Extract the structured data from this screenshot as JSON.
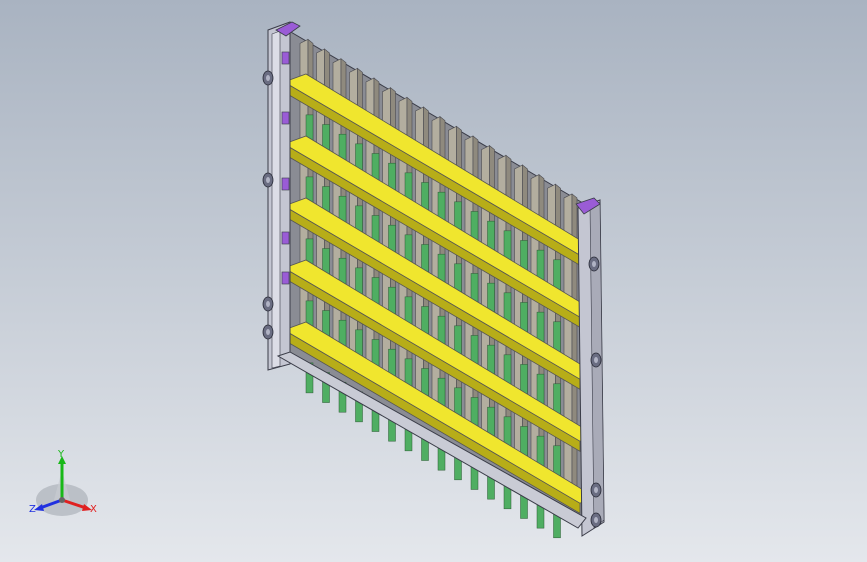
{
  "viewport": {
    "background_top": "#a9b3c1",
    "background_bottom": "#e4e7ec"
  },
  "model": {
    "name": "",
    "colors": {
      "frame": "#c4c6d2",
      "frame_edge": "#3a3c48",
      "ribs": "#8f8a7e",
      "ribs_light": "#b3ae9f",
      "shelves": "#f0e62e",
      "shelves_dark": "#b7ad18",
      "slats": "#4fae62",
      "corner_caps": "#9a5cd6",
      "bolts": "#6a6d82"
    },
    "counts": {
      "vertical_ribs": 17,
      "shelf_rows": 5,
      "side_bolts": 8
    }
  },
  "triad": {
    "labels": {
      "x": "X",
      "y": "Y",
      "z": "Z"
    },
    "colors": {
      "x": "#e02020",
      "y": "#18b818",
      "z": "#2030e0"
    }
  }
}
